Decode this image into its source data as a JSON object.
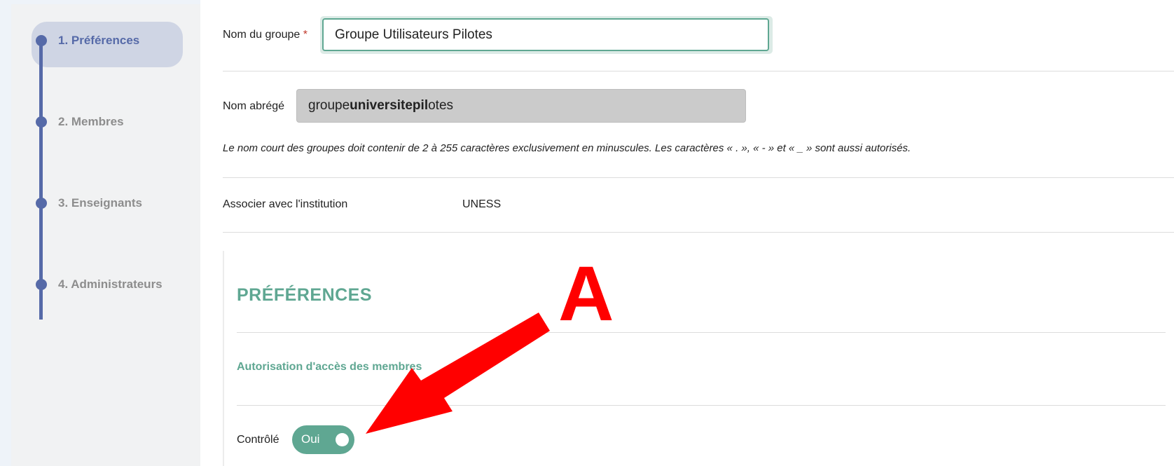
{
  "sidebar": {
    "steps": [
      {
        "label": "1. Préférences",
        "active": true
      },
      {
        "label": "2. Membres",
        "active": false
      },
      {
        "label": "3. Enseignants",
        "active": false
      },
      {
        "label": "4. Administrateurs",
        "active": false
      }
    ]
  },
  "form": {
    "group_name": {
      "label": "Nom du groupe",
      "required_mark": "*",
      "value": "Groupe Utilisateurs Pilotes"
    },
    "short_name": {
      "label": "Nom abrégé",
      "value_prefix": "groupe",
      "value_bold": "universitepil",
      "value_suffix": "otes",
      "hint": "Le nom court des groupes doit contenir de 2 à 255 caractères exclusivement en minuscules. Les caractères « . », « - » et « _ » sont aussi autorisés."
    },
    "institution": {
      "label": "Associer avec l'institution",
      "value": "UNESS"
    }
  },
  "preferences": {
    "title": "PRÉFÉRENCES",
    "subhead": "Autorisation d'accès des membres",
    "controlled": {
      "label": "Contrôlé",
      "toggle_label": "Oui",
      "state": true
    }
  },
  "annotation": {
    "letter": "A",
    "color": "#ff0000"
  },
  "colors": {
    "accent": "#5fa792",
    "step": "#566aa8"
  }
}
